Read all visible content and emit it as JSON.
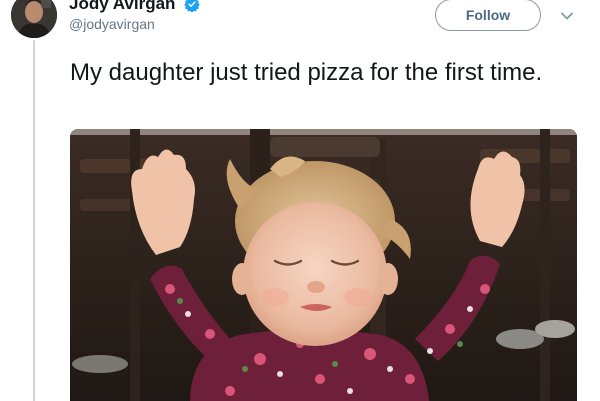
{
  "author": {
    "display_name": "Jody Avirgan",
    "handle": "@jodyavirgan",
    "verified": true,
    "avatar_icon": "avatar-photo"
  },
  "actions": {
    "follow_label": "Follow",
    "more_icon": "chevron-down-icon"
  },
  "tweet": {
    "text": "My daughter just tried pizza for the first time."
  },
  "media": {
    "type": "photo",
    "subject": "baby-with-raised-hands-photo"
  },
  "colors": {
    "follow_border": "#8a9aa8",
    "follow_text": "#4a6b85",
    "verified": "#1da1f2",
    "thread_line": "#ccd6dd",
    "name_text": "#14171a",
    "handle_text": "#657786"
  }
}
